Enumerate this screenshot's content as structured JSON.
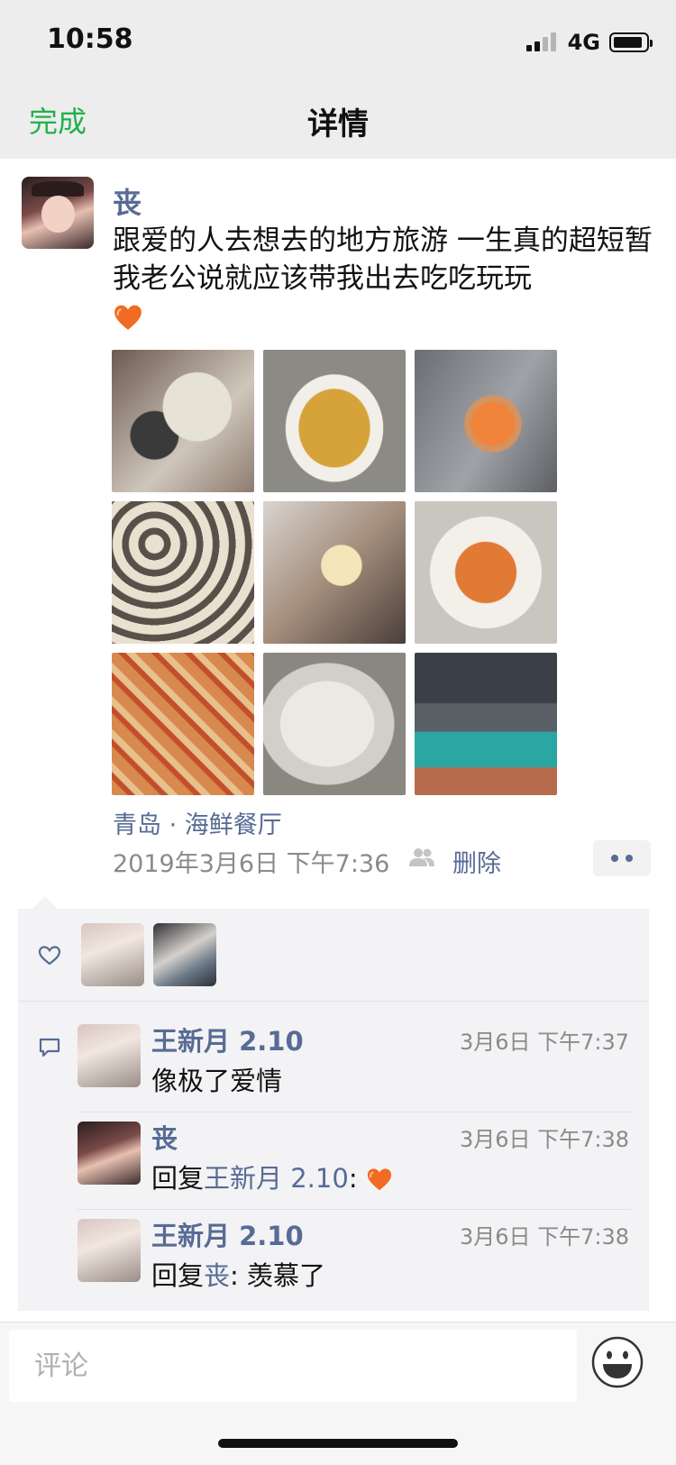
{
  "status_bar": {
    "time": "10:58",
    "network": "4G",
    "battery_level": 0.8
  },
  "nav": {
    "done_label": "完成",
    "title": "详情"
  },
  "post": {
    "author": "丧",
    "text": "跟爱的人去想去的地方旅游 一生真的超短暂 我老公说就应该带我出去吃吃玩玩",
    "emoji": "heart",
    "photo_count": 9,
    "location": "青岛 · 海鲜餐厅",
    "timestamp": "2019年3月6日 下午7:36",
    "privacy_icon": "friends-icon",
    "delete_label": "删除",
    "more_icon": "ellipsis-icon"
  },
  "likes": {
    "icon": "heart-outline-icon",
    "liker_count": 2
  },
  "comments": [
    {
      "name": "王新月 2.10",
      "time": "3月6日 下午7:37",
      "text": "像极了爱情"
    },
    {
      "name": "丧",
      "time": "3月6日 下午7:38",
      "reply_prefix": "回复",
      "reply_to": "王新月 2.10",
      "reply_sep": ":",
      "emoji": "heart"
    },
    {
      "name": "王新月 2.10",
      "time": "3月6日 下午7:38",
      "reply_prefix": "回复",
      "reply_to": "丧",
      "reply_sep": ":",
      "text": "羡慕了"
    }
  ],
  "input": {
    "placeholder": "评论",
    "value": "",
    "emoji_icon": "smiley-icon"
  },
  "colors": {
    "link": "#576b95",
    "accent": "#20b14b",
    "panel": "#f3f3f5",
    "bar": "#ededed"
  }
}
